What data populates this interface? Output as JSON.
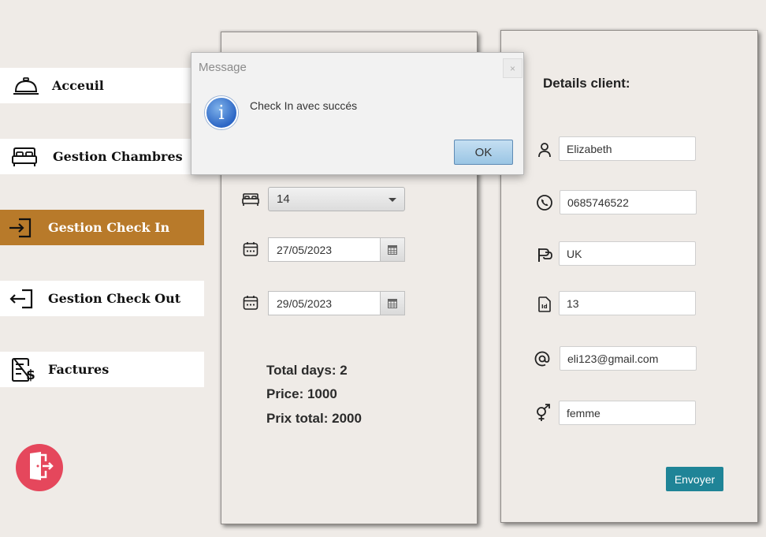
{
  "sidebar": {
    "items": [
      {
        "label": "Acceuil",
        "icon": "service-bell-icon"
      },
      {
        "label": "Gestion Chambres",
        "icon": "bed-icon"
      },
      {
        "label": "Gestion Check In",
        "icon": "check-in-icon",
        "active": true
      },
      {
        "label": "Gestion Check Out",
        "icon": "check-out-icon"
      },
      {
        "label": "Factures",
        "icon": "invoice-dollar-icon"
      }
    ],
    "active_color": "#b87a2a",
    "exit_icon": "logout-door-icon",
    "exit_color": "#e5475c"
  },
  "checkin": {
    "room": "14",
    "date_in": "27/05/2023",
    "date_out": "29/05/2023",
    "total_days": "Total days: 2",
    "price": "Price: 1000",
    "total_price": "Prix total: 2000"
  },
  "client": {
    "title": "Details client:",
    "name": "Elizabeth",
    "phone": "0685746522",
    "country": "UK",
    "id": "13",
    "email": "eli123@gmail.com",
    "gender": "femme",
    "submit_label": "Envoyer",
    "submit_color": "#1f8497"
  },
  "dialog": {
    "title": "Message",
    "close": "×",
    "info_glyph": "i",
    "message": "Check In avec succés",
    "ok_label": "OK"
  }
}
